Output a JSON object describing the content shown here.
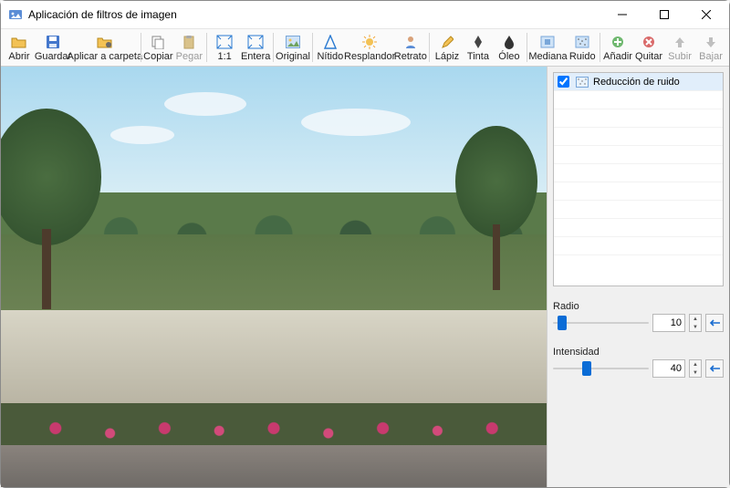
{
  "window": {
    "title": "Aplicación de filtros de imagen"
  },
  "toolbar": {
    "abrir": "Abrir",
    "guardar": "Guardar",
    "aplicar_carpeta": "Aplicar a carpeta",
    "copiar": "Copiar",
    "pegar": "Pegar",
    "uno_uno": "1:1",
    "entera": "Entera",
    "original": "Original",
    "nitido": "Nítido",
    "resplandor": "Resplandor",
    "retrato": "Retrato",
    "lapiz": "Lápiz",
    "tinta": "Tinta",
    "oleo": "Óleo",
    "mediana": "Mediana",
    "ruido": "Ruido",
    "anadir": "Añadir",
    "quitar": "Quitar",
    "subir": "Subir",
    "bajar": "Bajar"
  },
  "filters": {
    "items": [
      {
        "label": "Reducción de ruido",
        "checked": true
      }
    ]
  },
  "params": {
    "radio": {
      "label": "Radio",
      "value": "10",
      "pct": 5
    },
    "intensidad": {
      "label": "Intensidad",
      "value": "40",
      "pct": 30
    }
  }
}
